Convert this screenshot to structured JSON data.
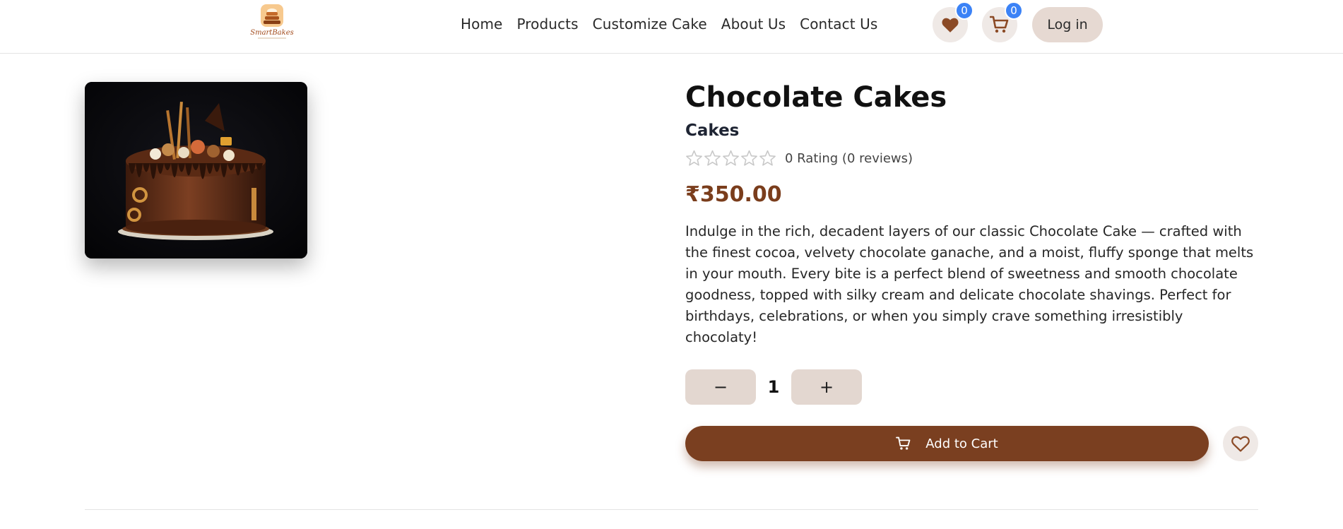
{
  "header": {
    "logo_text": "SmartBakes",
    "nav": [
      "Home",
      "Products",
      "Customize Cake",
      "About Us",
      "Contact Us"
    ],
    "wishlist_count": "0",
    "cart_count": "0",
    "login_label": "Log in"
  },
  "product": {
    "title": "Chocolate Cakes",
    "category": "Cakes",
    "rating_text": "0 Rating (0 reviews)",
    "rating_value": 0,
    "rating_max": 5,
    "price": "₹350.00",
    "description": "Indulge in the rich, decadent layers of our classic Chocolate Cake — crafted with the finest cocoa, velvety chocolate ganache, and a moist, fluffy sponge that melts in your mouth. Every bite is a perfect blend of sweetness and smooth chocolate goodness, topped with silky cream and delicate chocolate shavings. Perfect for birthdays, celebrations, or when you simply crave something irresistibly chocolaty!",
    "quantity": "1",
    "decrement_label": "−",
    "increment_label": "+",
    "add_to_cart_label": "Add to Cart"
  },
  "colors": {
    "brand_brown": "#7a3f20",
    "price_brown": "#7a3d1c",
    "badge_blue": "#3b82f6",
    "soft_beige": "#e6d9d2"
  },
  "icons": [
    "heart-icon",
    "cart-icon",
    "star-outline-icon"
  ]
}
